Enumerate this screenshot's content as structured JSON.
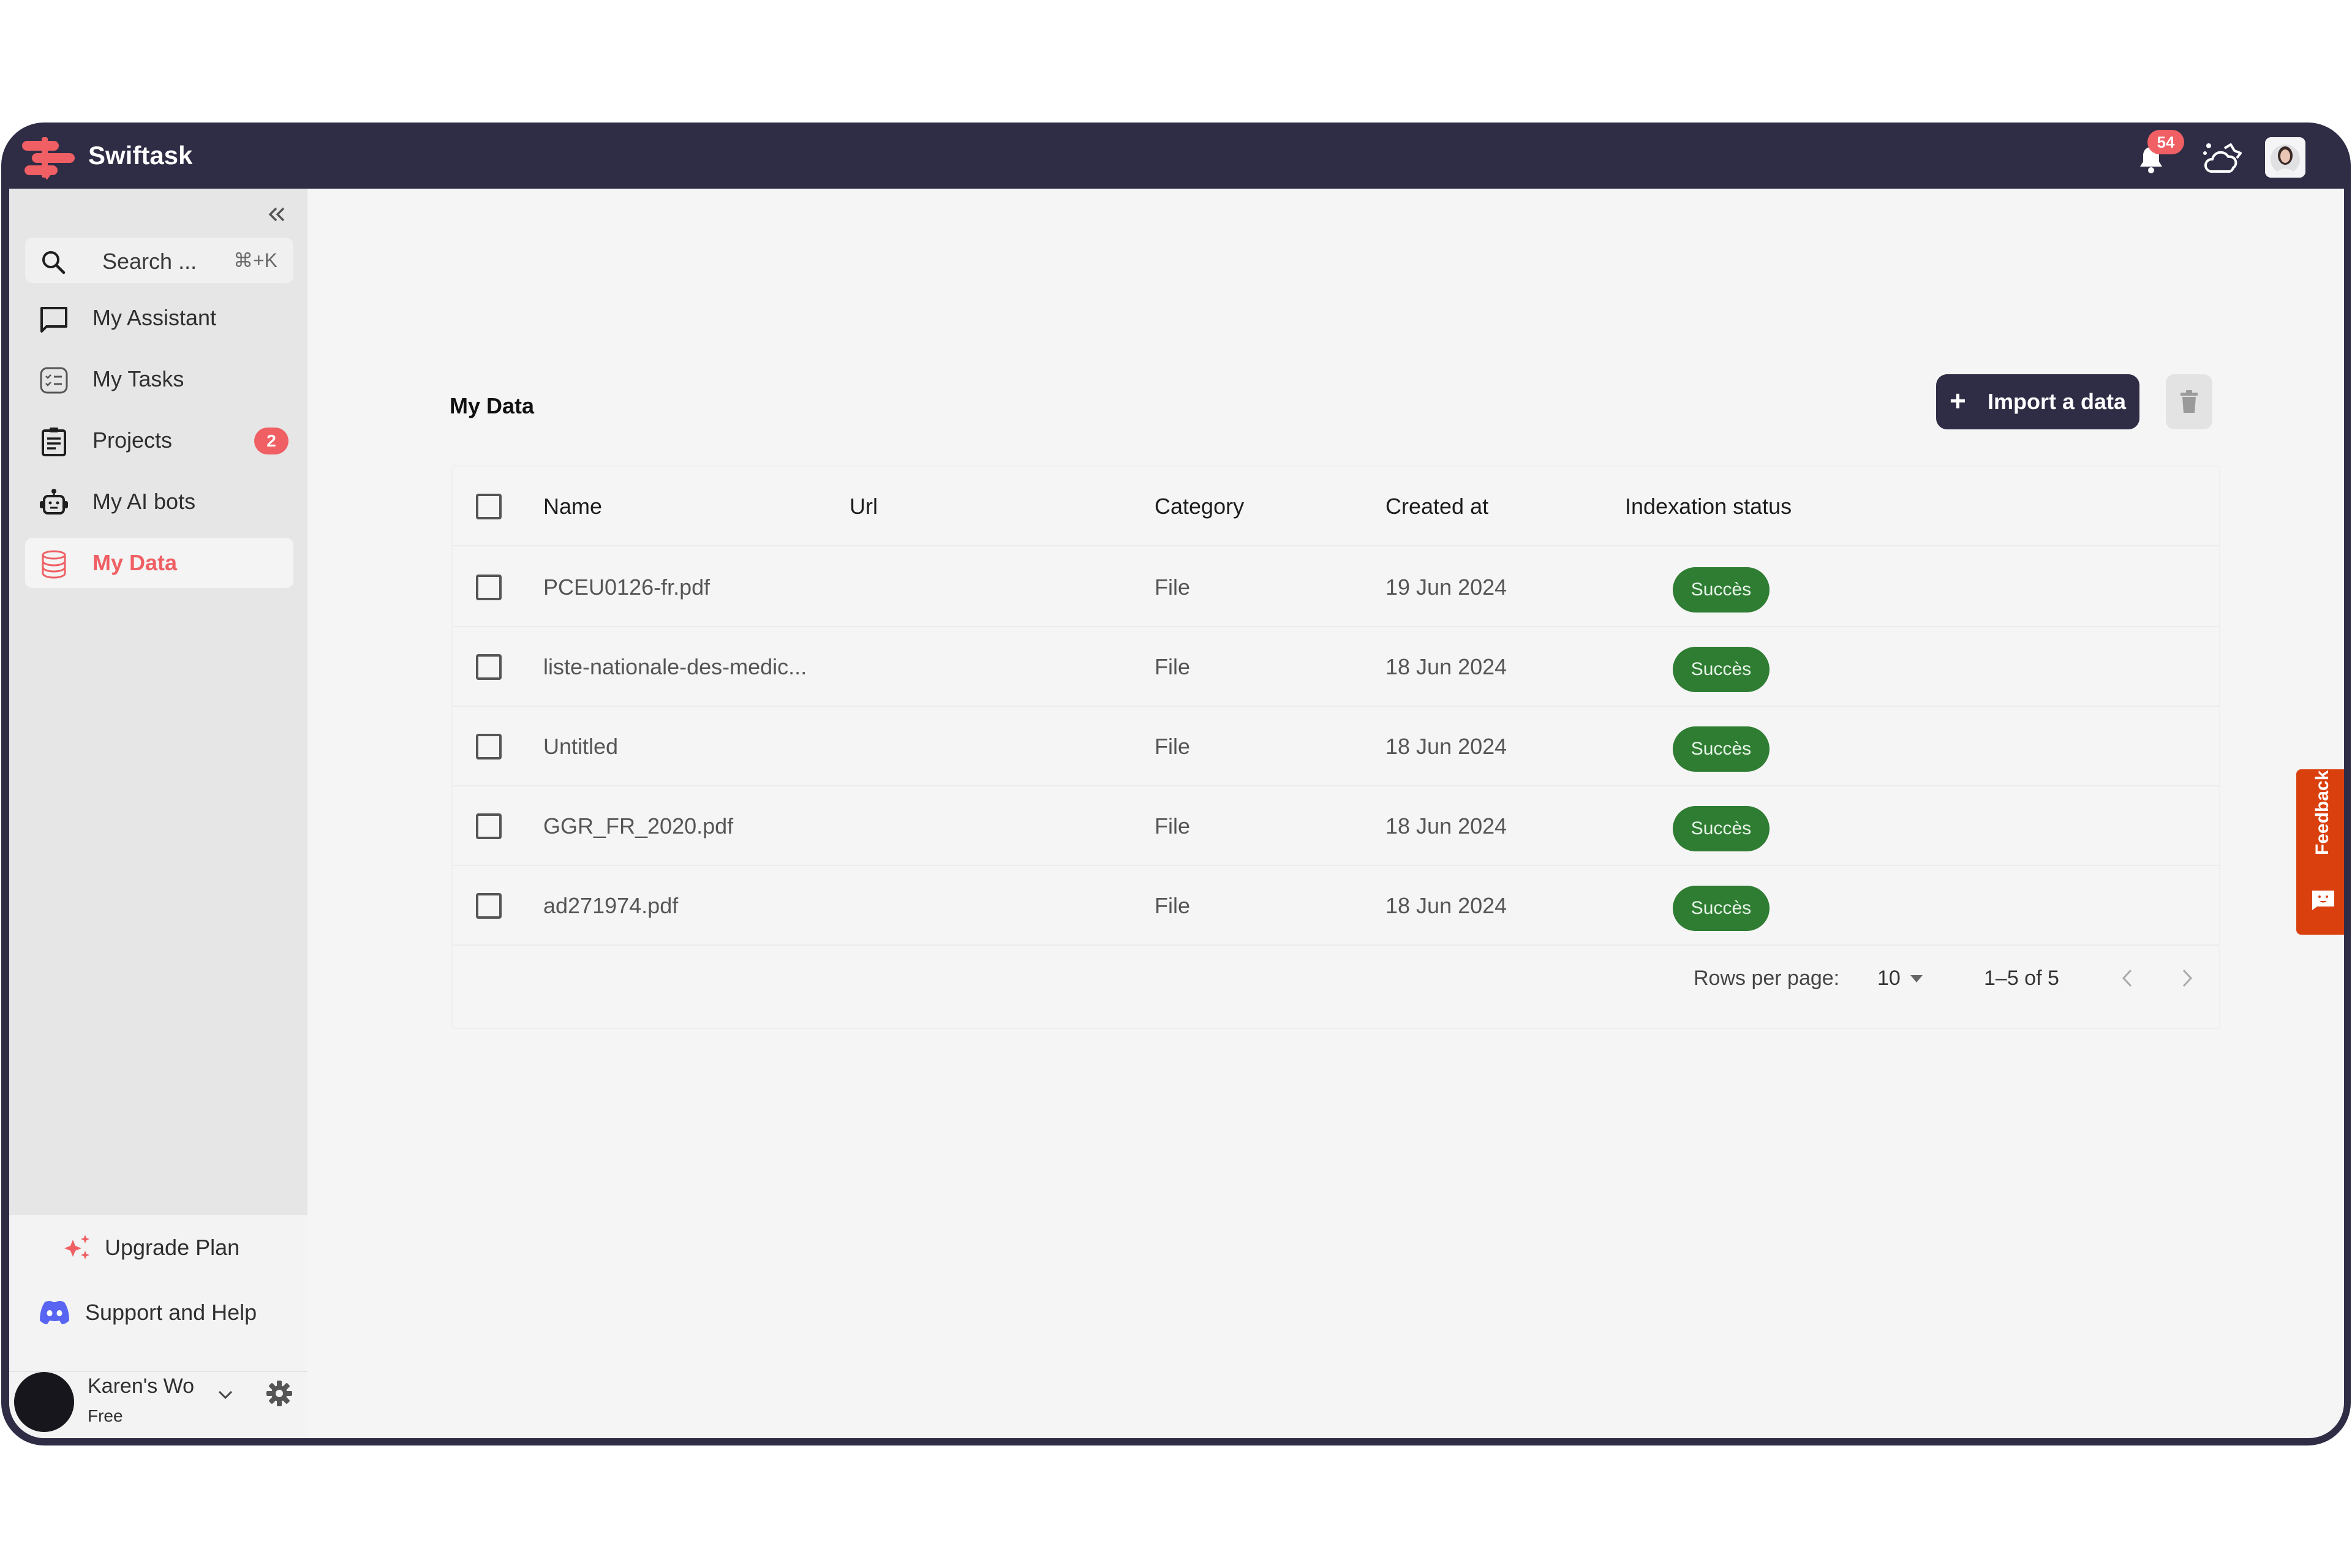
{
  "app": {
    "name": "Swiftask",
    "brand_color": "#ef5f63",
    "header_color": "#2f2c45"
  },
  "topbar": {
    "notifications_count": "54",
    "icons": [
      "bell-icon",
      "weather-icon",
      "user-avatar"
    ]
  },
  "sidebar": {
    "collapse_icon": "double-chevron-left-icon",
    "search": {
      "placeholder": "Search ...",
      "shortcut": "⌘+K"
    },
    "items": [
      {
        "label": "My Assistant",
        "icon": "chat-icon",
        "active": false
      },
      {
        "label": "My Tasks",
        "icon": "tasks-icon",
        "active": false
      },
      {
        "label": "Projects",
        "icon": "clipboard-icon",
        "active": false,
        "badge": "2"
      },
      {
        "label": "My AI bots",
        "icon": "robot-icon",
        "active": false
      },
      {
        "label": "My Data",
        "icon": "database-icon",
        "active": true
      }
    ],
    "upgrade_label": "Upgrade Plan",
    "support_label": "Support and Help",
    "user": {
      "name": "Karen's Wo",
      "plan": "Free"
    }
  },
  "main": {
    "title": "My Data",
    "import_button": "Import a data",
    "table": {
      "columns": [
        "Name",
        "Url",
        "Category",
        "Created at",
        "Indexation status"
      ],
      "rows": [
        {
          "name": "PCEU0126-fr.pdf",
          "url": "",
          "category": "File",
          "created_at": "19 Jun 2024",
          "status": "Succès"
        },
        {
          "name": "liste-nationale-des-medic...",
          "url": "",
          "category": "File",
          "created_at": "18 Jun 2024",
          "status": "Succès"
        },
        {
          "name": "Untitled",
          "url": "",
          "category": "File",
          "created_at": "18 Jun 2024",
          "status": "Succès"
        },
        {
          "name": "GGR_FR_2020.pdf",
          "url": "",
          "category": "File",
          "created_at": "18 Jun 2024",
          "status": "Succès"
        },
        {
          "name": "ad271974.pdf",
          "url": "",
          "category": "File",
          "created_at": "18 Jun 2024",
          "status": "Succès"
        }
      ],
      "status_color": "#2e7d32"
    },
    "pagination": {
      "rows_per_page_label": "Rows per page:",
      "rows_per_page_value": "10",
      "range": "1–5 of 5"
    }
  },
  "feedback": {
    "label": "Feedback",
    "color": "#d9400e"
  }
}
